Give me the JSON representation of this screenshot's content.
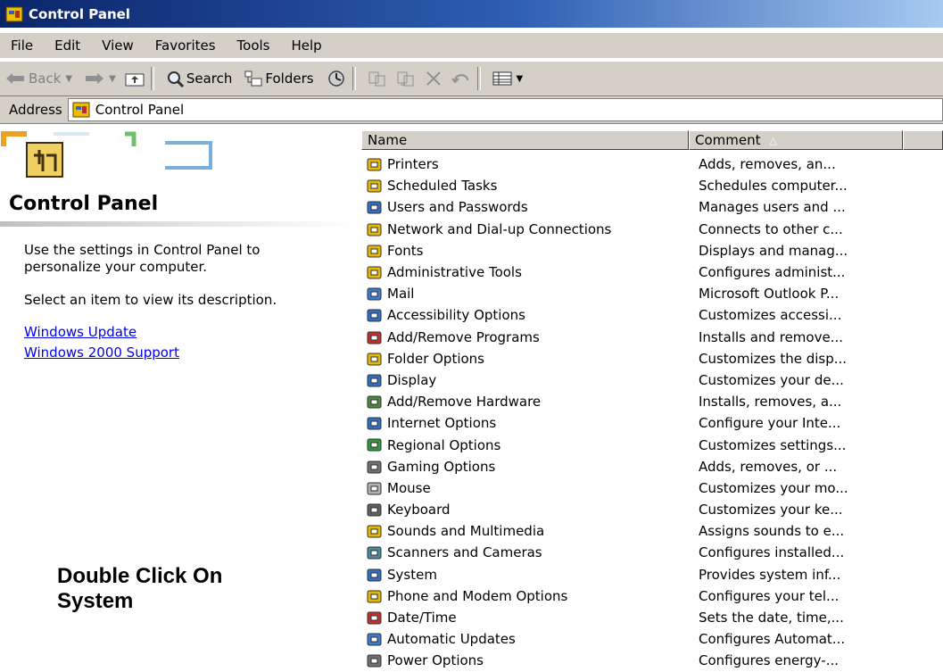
{
  "window": {
    "title": "Control Panel"
  },
  "menu": [
    "File",
    "Edit",
    "View",
    "Favorites",
    "Tools",
    "Help"
  ],
  "toolbar": {
    "back": "Back",
    "search": "Search",
    "folders": "Folders"
  },
  "address": {
    "label": "Address",
    "value": "Control Panel"
  },
  "left": {
    "title": "Control Panel",
    "desc1a": "Use the settings in Control Panel to",
    "desc1b": "personalize your computer.",
    "desc2": "Select an item to view its description.",
    "link1": "Windows Update",
    "link2": "Windows 2000 Support",
    "note1": "Double Click On",
    "note2": "System"
  },
  "list": {
    "headers": {
      "name": "Name",
      "comment": "Comment"
    },
    "items": [
      {
        "name": "Printers",
        "comment": "Adds, removes, an...",
        "icon": "printer-folder-icon",
        "color": "#e8b800"
      },
      {
        "name": "Scheduled Tasks",
        "comment": "Schedules computer...",
        "icon": "scheduled-tasks-icon",
        "color": "#e8b800"
      },
      {
        "name": "Users and Passwords",
        "comment": "Manages users and ...",
        "icon": "users-icon",
        "color": "#2f6fc9"
      },
      {
        "name": "Network and Dial-up Connections",
        "comment": "Connects to other c...",
        "icon": "network-icon",
        "color": "#e8b800"
      },
      {
        "name": "Fonts",
        "comment": "Displays and manag...",
        "icon": "fonts-icon",
        "color": "#e8b800"
      },
      {
        "name": "Administrative Tools",
        "comment": "Configures administ...",
        "icon": "admin-tools-icon",
        "color": "#e8b800"
      },
      {
        "name": "Mail",
        "comment": "Microsoft Outlook P...",
        "icon": "mail-icon",
        "color": "#3a7bd5"
      },
      {
        "name": "Accessibility Options",
        "comment": "Customizes accessi...",
        "icon": "accessibility-icon",
        "color": "#2f6fc9"
      },
      {
        "name": "Add/Remove Programs",
        "comment": "Installs and remove...",
        "icon": "add-remove-programs-icon",
        "color": "#c03030"
      },
      {
        "name": "Folder Options",
        "comment": "Customizes the disp...",
        "icon": "folder-options-icon",
        "color": "#e8b800"
      },
      {
        "name": "Display",
        "comment": "Customizes your de...",
        "icon": "display-icon",
        "color": "#2f6fc9"
      },
      {
        "name": "Add/Remove Hardware",
        "comment": "Installs, removes, a...",
        "icon": "add-remove-hardware-icon",
        "color": "#4a8a3a"
      },
      {
        "name": "Internet Options",
        "comment": "Configure your Inte...",
        "icon": "internet-options-icon",
        "color": "#2f6fc9"
      },
      {
        "name": "Regional Options",
        "comment": "Customizes settings...",
        "icon": "regional-options-icon",
        "color": "#2f9a3a"
      },
      {
        "name": "Gaming Options",
        "comment": "Adds, removes, or ...",
        "icon": "gaming-options-icon",
        "color": "#707070"
      },
      {
        "name": "Mouse",
        "comment": "Customizes your mo...",
        "icon": "mouse-icon",
        "color": "#b0b0b0"
      },
      {
        "name": "Keyboard",
        "comment": "Customizes your ke...",
        "icon": "keyboard-icon",
        "color": "#606060"
      },
      {
        "name": "Sounds and Multimedia",
        "comment": "Assigns sounds to e...",
        "icon": "sounds-icon",
        "color": "#e8b800"
      },
      {
        "name": "Scanners and Cameras",
        "comment": "Configures installed...",
        "icon": "scanners-icon",
        "color": "#4a8a9a"
      },
      {
        "name": "System",
        "comment": "Provides system inf...",
        "icon": "system-icon",
        "color": "#2f6fc9"
      },
      {
        "name": "Phone and Modem Options",
        "comment": "Configures your tel...",
        "icon": "phone-modem-icon",
        "color": "#e8b800"
      },
      {
        "name": "Date/Time",
        "comment": "Sets the date, time,...",
        "icon": "date-time-icon",
        "color": "#c03030"
      },
      {
        "name": "Automatic Updates",
        "comment": "Configures Automat...",
        "icon": "automatic-updates-icon",
        "color": "#3a7bd5"
      },
      {
        "name": "Power Options",
        "comment": "Configures energy-...",
        "icon": "power-options-icon",
        "color": "#707070"
      }
    ]
  },
  "colors": {
    "title_bar": "#0a246a",
    "chrome": "#d4d0c8",
    "link": "#0000ee"
  }
}
